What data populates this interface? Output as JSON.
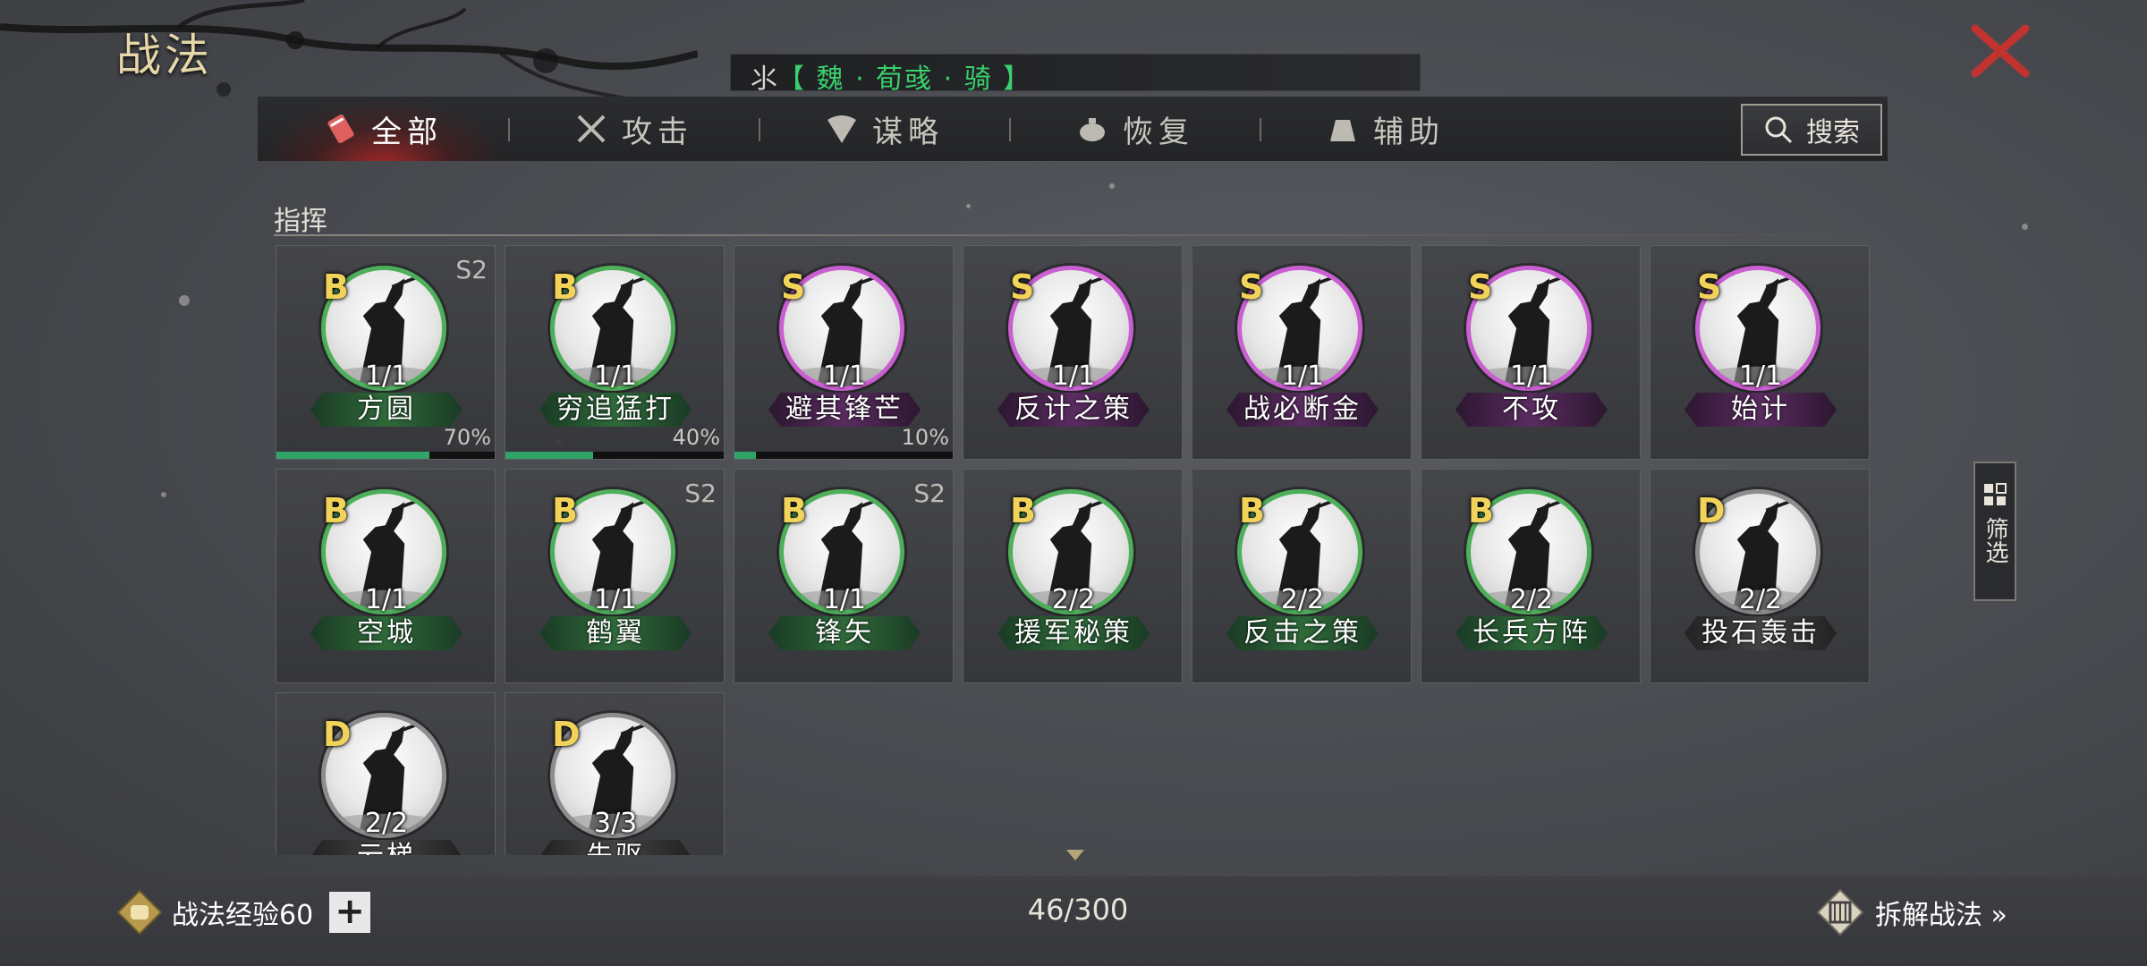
{
  "header": {
    "title": "战法"
  },
  "unit_bar": {
    "prefix": "⺢",
    "text": "【 魏 · 荀彧 · 骑 】"
  },
  "tabs": [
    {
      "label": "全部",
      "icon": "scroll-icon",
      "active": true
    },
    {
      "label": "攻击",
      "icon": "crossed-swords-icon",
      "active": false
    },
    {
      "label": "谋略",
      "icon": "fan-icon",
      "active": false
    },
    {
      "label": "恢复",
      "icon": "teapot-icon",
      "active": false
    },
    {
      "label": "辅助",
      "icon": "pouch-icon",
      "active": false
    }
  ],
  "search": {
    "label": "搜索"
  },
  "section": {
    "title": "指挥"
  },
  "colors": {
    "grade_B": "#4fae5a",
    "grade_S": "#c95fd0",
    "grade_D": "#8d8d8d",
    "progress": "#2fa368",
    "unit_text": "#39d06d"
  },
  "cards": [
    {
      "grade": "B",
      "count": "1/1",
      "name": "方圆",
      "season": "S2",
      "progress": 70,
      "progress_label": "70%"
    },
    {
      "grade": "B",
      "count": "1/1",
      "name": "穷追猛打",
      "season": "",
      "progress": 40,
      "progress_label": "40%"
    },
    {
      "grade": "S",
      "count": "1/1",
      "name": "避其锋芒",
      "season": "",
      "progress": 10,
      "progress_label": "10%"
    },
    {
      "grade": "S",
      "count": "1/1",
      "name": "反计之策",
      "season": ""
    },
    {
      "grade": "S",
      "count": "1/1",
      "name": "战必断金",
      "season": ""
    },
    {
      "grade": "S",
      "count": "1/1",
      "name": "不攻",
      "season": ""
    },
    {
      "grade": "S",
      "count": "1/1",
      "name": "始计",
      "season": ""
    },
    {
      "grade": "B",
      "count": "1/1",
      "name": "空城",
      "season": ""
    },
    {
      "grade": "B",
      "count": "1/1",
      "name": "鹤翼",
      "season": "S2"
    },
    {
      "grade": "B",
      "count": "1/1",
      "name": "锋矢",
      "season": "S2"
    },
    {
      "grade": "B",
      "count": "2/2",
      "name": "援军秘策",
      "season": ""
    },
    {
      "grade": "B",
      "count": "2/2",
      "name": "反击之策",
      "season": ""
    },
    {
      "grade": "B",
      "count": "2/2",
      "name": "长兵方阵",
      "season": ""
    },
    {
      "grade": "D",
      "count": "2/2",
      "name": "投石轰击",
      "season": ""
    },
    {
      "grade": "D",
      "count": "2/2",
      "name": "云梯",
      "season": ""
    },
    {
      "grade": "D",
      "count": "3/3",
      "name": "先驱",
      "season": ""
    }
  ],
  "filter": {
    "label": "筛选"
  },
  "footer": {
    "exp_label": "战法经验60",
    "plus": "+",
    "capacity": "46/300",
    "decompose_label": "拆解战法 »"
  }
}
